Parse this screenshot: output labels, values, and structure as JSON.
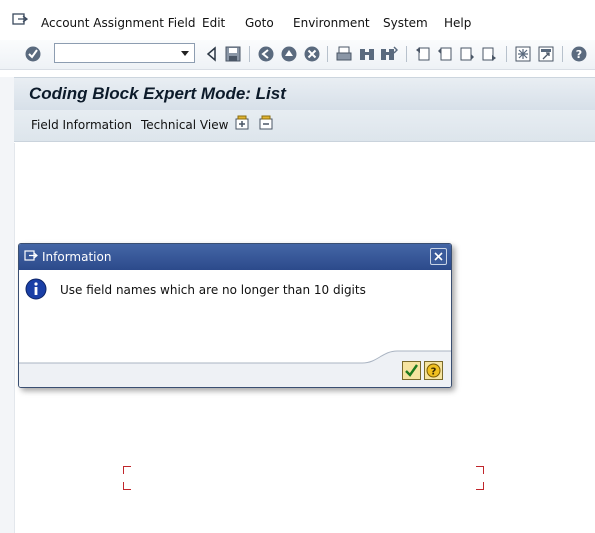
{
  "menubar": {
    "items": [
      {
        "label": "Account Assignment Field"
      },
      {
        "label": "Edit"
      },
      {
        "label": "Goto"
      },
      {
        "label": "Environment"
      },
      {
        "label": "System"
      },
      {
        "label": "Help"
      }
    ]
  },
  "toolbar": {
    "command_field": {
      "value": "",
      "placeholder": ""
    },
    "icons": [
      "enter-icon",
      "back-icon",
      "save-icon",
      "back-nav-icon",
      "exit-icon",
      "cancel-icon",
      "print-icon",
      "find-icon",
      "find-next-icon",
      "first-page-icon",
      "prev-page-icon",
      "next-page-icon",
      "last-page-icon",
      "new-session-icon",
      "shortcut-icon",
      "help-icon"
    ]
  },
  "title": "Coding Block Expert Mode: List",
  "app_toolbar": {
    "field_information": "Field Information",
    "technical_view": "Technical View"
  },
  "dialog": {
    "title": "Information",
    "message": "Use field names which are no longer than 10 digits"
  },
  "colors": {
    "dialog_title_bar": "#3557a0",
    "info_icon": "#1a3fa6",
    "accent_red": "#c0262b"
  }
}
